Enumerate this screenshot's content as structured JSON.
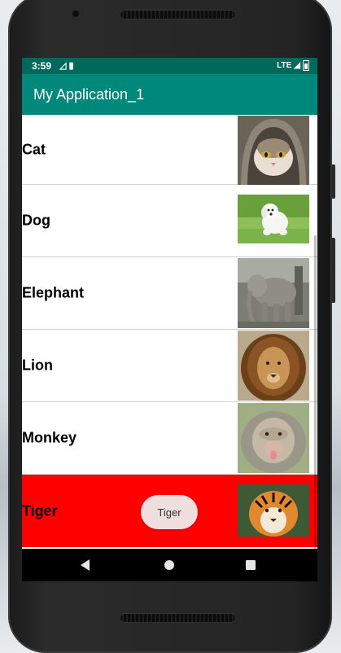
{
  "status_bar": {
    "time": "3:59",
    "network": "LTE"
  },
  "app_bar": {
    "title": "My Application_1"
  },
  "list": {
    "items": [
      {
        "label": "Cat",
        "image": "cat-photo"
      },
      {
        "label": "Dog",
        "image": "dog-photo"
      },
      {
        "label": "Elephant",
        "image": "elephant-photo"
      },
      {
        "label": "Lion",
        "image": "lion-photo"
      },
      {
        "label": "Monkey",
        "image": "monkey-photo"
      },
      {
        "label": "Tiger",
        "image": "tiger-photo"
      }
    ],
    "selected_index": 5
  },
  "toast": {
    "text": "Tiger"
  },
  "nav_bar": {
    "icons": [
      "back-icon",
      "home-icon",
      "recents-icon"
    ]
  },
  "colors": {
    "status_bar": "#00695c",
    "app_bar": "#00897b",
    "selected_row": "#ff0000"
  }
}
